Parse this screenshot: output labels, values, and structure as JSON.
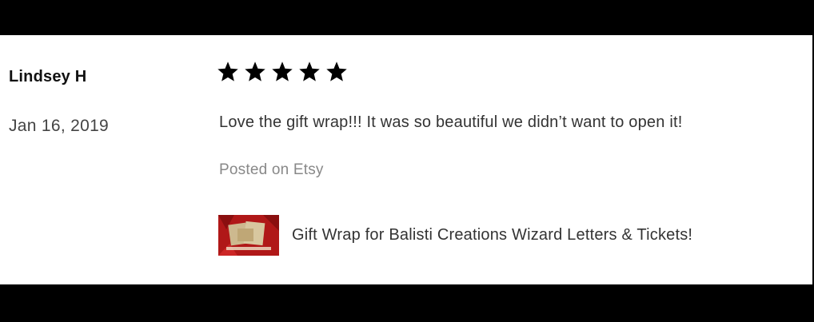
{
  "review": {
    "reviewer_name": "Lindsey H",
    "date": "Jan 16, 2019",
    "rating": 5,
    "rating_max": 5,
    "text": "Love the gift wrap!!! It was so beautiful we didn’t want to open it!",
    "source": "Posted on Etsy"
  },
  "product": {
    "title": "Gift Wrap for Balisti Creations Wizard Letters & Tickets!",
    "thumbnail_icon": "gift-wrap-thumbnail"
  },
  "colors": {
    "star": "#000000",
    "panel_bg": "#ffffff",
    "frame_bg": "#000000",
    "thumb_red": "#b01818",
    "thumb_paper": "#c8b48a"
  }
}
